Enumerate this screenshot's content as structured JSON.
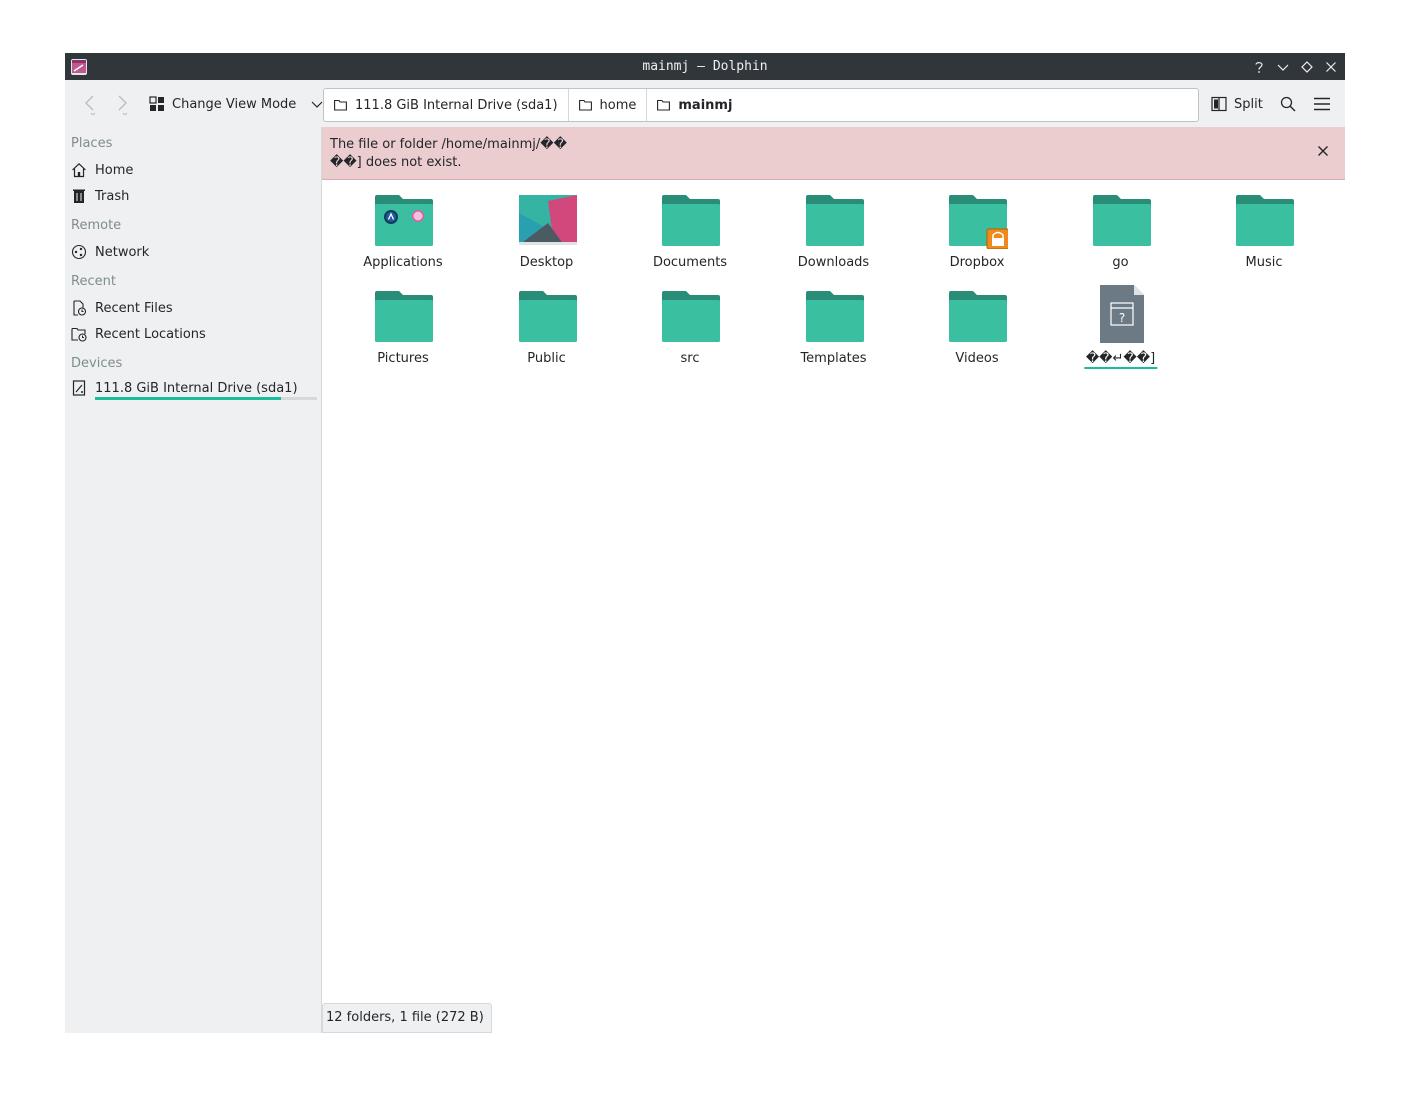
{
  "window": {
    "title": "mainmj — Dolphin"
  },
  "toolbar": {
    "view_mode_label": "Change View Mode",
    "split_label": "Split",
    "breadcrumbs": [
      {
        "label": "111.8 GiB Internal Drive (sda1)"
      },
      {
        "label": "home"
      },
      {
        "label": "mainmj"
      }
    ]
  },
  "sidebar": {
    "sections": {
      "places": "Places",
      "remote": "Remote",
      "recent": "Recent",
      "devices": "Devices"
    },
    "items": {
      "home": "Home",
      "trash": "Trash",
      "network": "Network",
      "recent_files": "Recent Files",
      "recent_locations": "Recent Locations",
      "drive": "111.8 GiB Internal Drive (sda1)"
    },
    "drive_usage_fraction": 0.84
  },
  "error_banner": {
    "message": "The file or folder /home/mainmj/��\n��] does not exist."
  },
  "files": [
    {
      "name": "Applications",
      "icon": "folder-applications-icon"
    },
    {
      "name": "Desktop",
      "icon": "folder-desktop-icon"
    },
    {
      "name": "Documents",
      "icon": "folder-icon"
    },
    {
      "name": "Downloads",
      "icon": "folder-icon"
    },
    {
      "name": "Dropbox",
      "icon": "folder-locked-icon"
    },
    {
      "name": "go",
      "icon": "folder-icon"
    },
    {
      "name": "Music",
      "icon": "folder-icon"
    },
    {
      "name": "Pictures",
      "icon": "folder-icon"
    },
    {
      "name": "Public",
      "icon": "folder-icon"
    },
    {
      "name": "src",
      "icon": "folder-icon"
    },
    {
      "name": "Templates",
      "icon": "folder-icon"
    },
    {
      "name": "Videos",
      "icon": "folder-icon"
    },
    {
      "name": "��↵��]",
      "icon": "unknown-file-icon"
    }
  ],
  "statusbar": {
    "text": "12 folders, 1 file (272 B)"
  },
  "colors": {
    "folder": "#3bbfa1",
    "folder_tab": "#2a8d78",
    "titlebar": "#31363b",
    "error_bg": "#ebcdd0",
    "accent": "#1abc9c"
  }
}
